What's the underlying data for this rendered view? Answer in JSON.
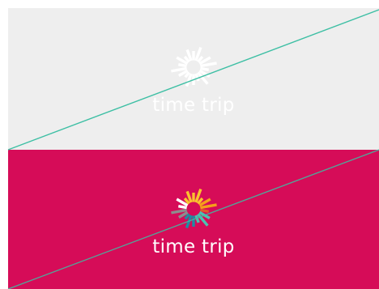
{
  "logo_light": {
    "wordmark": "time trip",
    "background": "#eeeeee",
    "mark_color": "#ffffff",
    "text_color": "#ffffff"
  },
  "logo_dark": {
    "wordmark": "time trip",
    "background": "#d60c58",
    "text_color": "#ffffff",
    "mark_colors": [
      "#f9c22e",
      "#f59f1b",
      "#e2592a",
      "#4cc2b1",
      "#1f8ca3",
      "#8d8d8d",
      "#ffffff"
    ]
  },
  "guide_line_color": "#3dbfa4"
}
